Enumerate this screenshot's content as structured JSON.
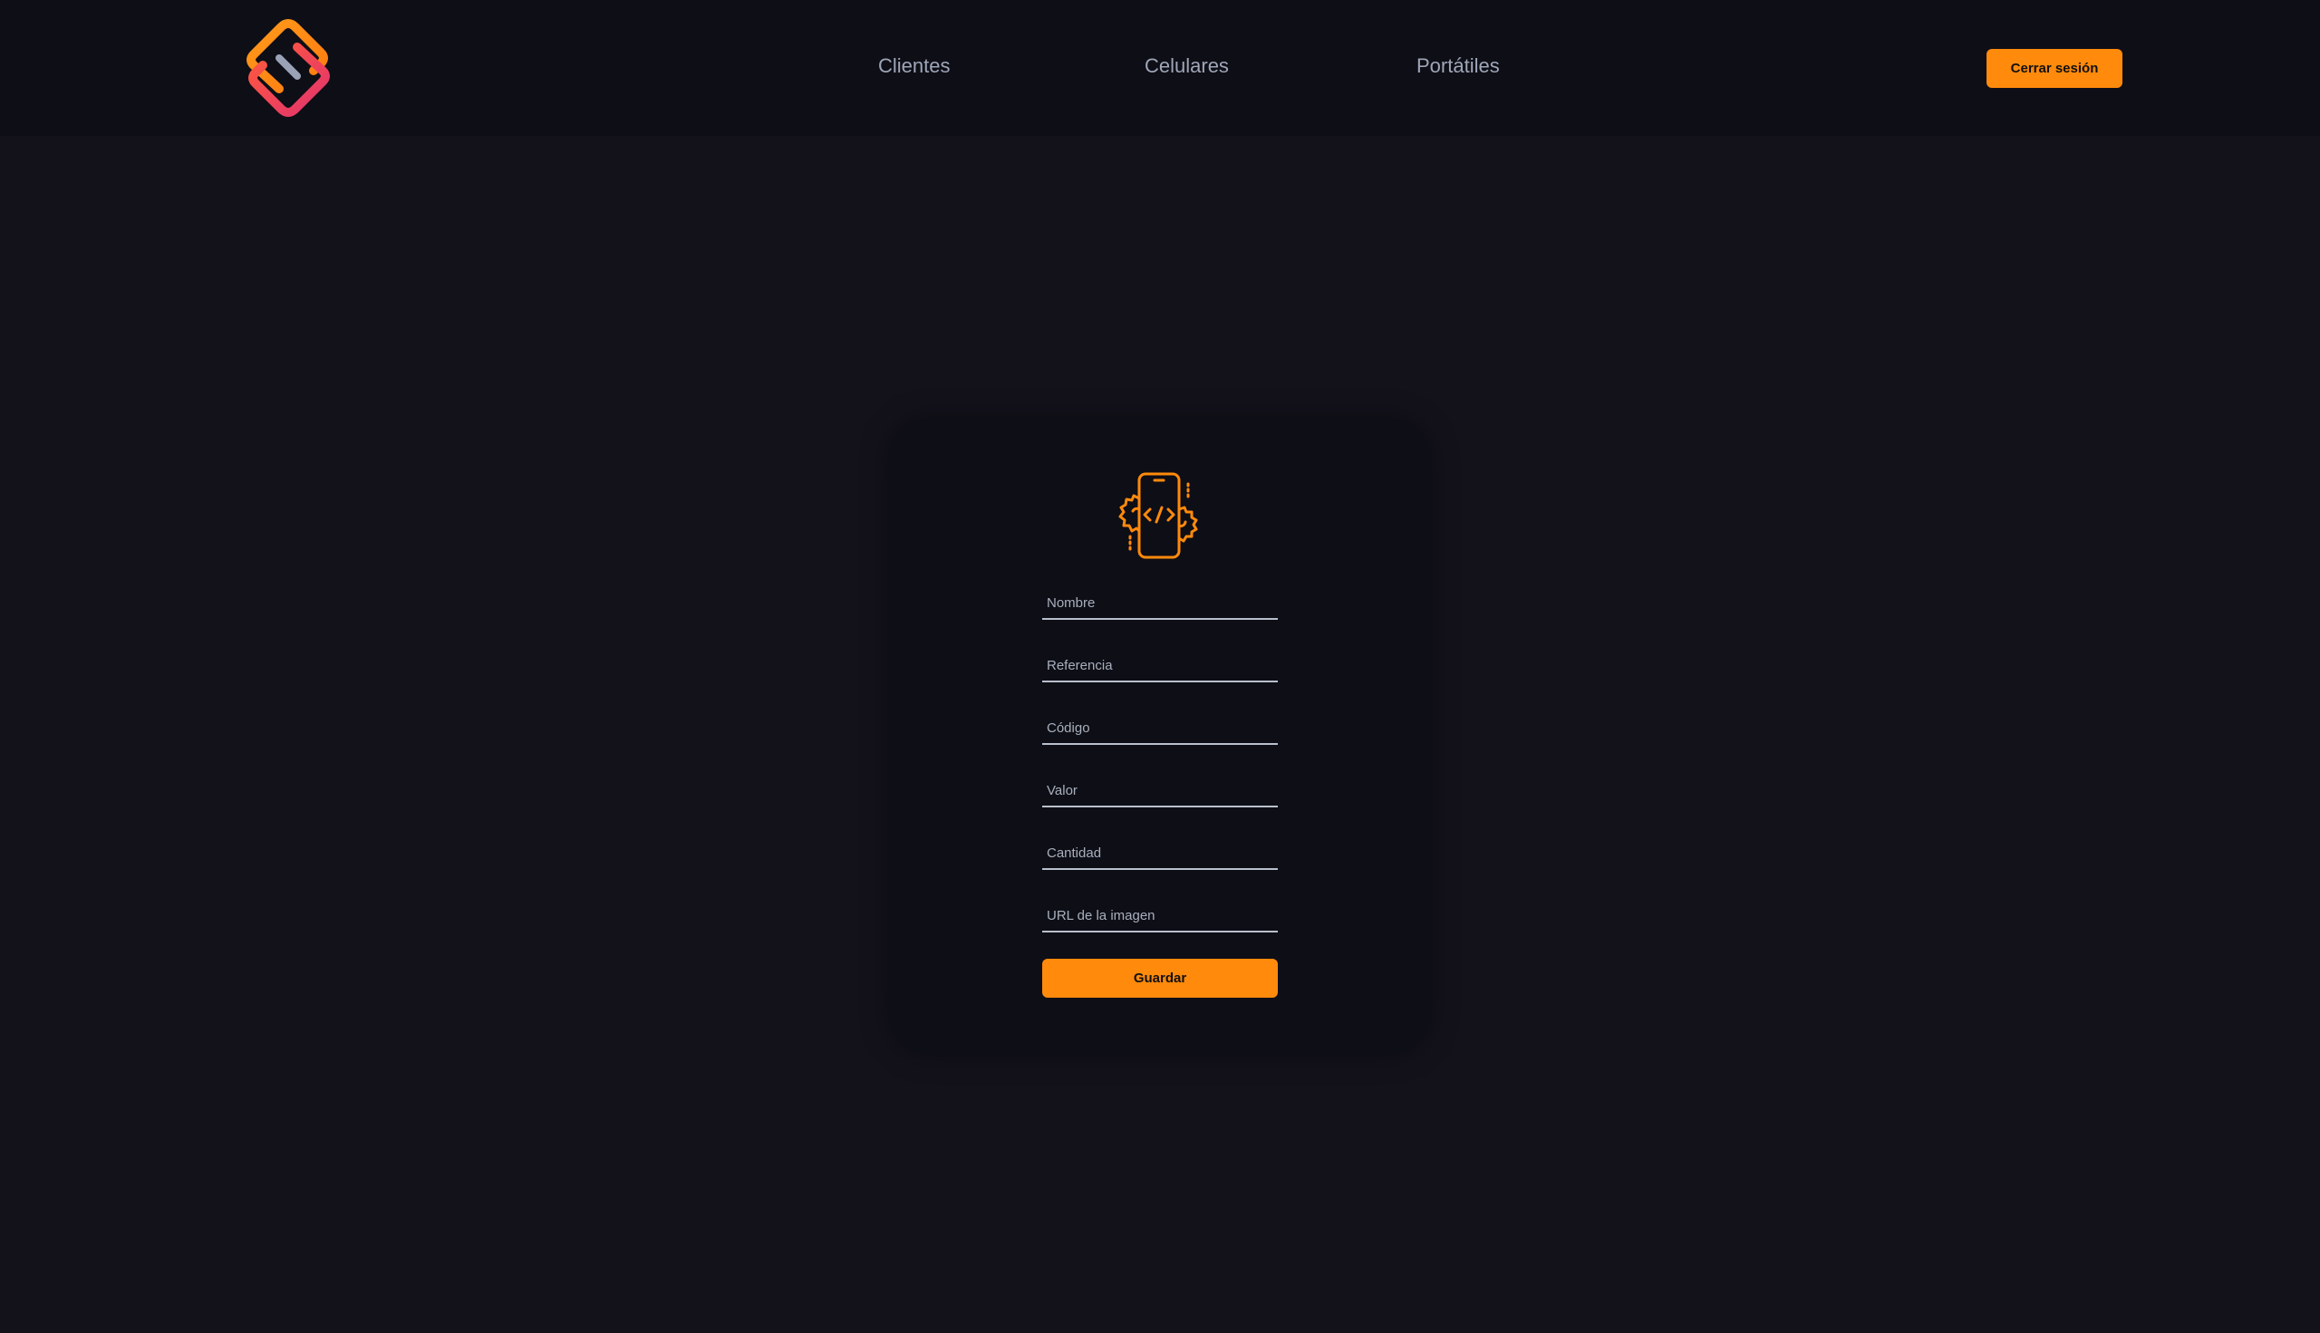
{
  "navbar": {
    "logo_icon": "brand-s-logo-icon",
    "links": [
      "Clientes",
      "Celulares",
      "Portátiles"
    ],
    "logout_label": "Cerrar sesión"
  },
  "form": {
    "icon": "phone-code-gears-icon",
    "fields": [
      {
        "placeholder": "Nombre",
        "value": ""
      },
      {
        "placeholder": "Referencia",
        "value": ""
      },
      {
        "placeholder": "Código",
        "value": ""
      },
      {
        "placeholder": "Valor",
        "value": ""
      },
      {
        "placeholder": "Cantidad",
        "value": ""
      },
      {
        "placeholder": "URL de la imagen",
        "value": ""
      }
    ],
    "save_label": "Guardar"
  },
  "colors": {
    "accent": "#ff8a0c",
    "logo_pink": "#e8336f",
    "background": "#13121b",
    "surface": "#0e0e16"
  }
}
